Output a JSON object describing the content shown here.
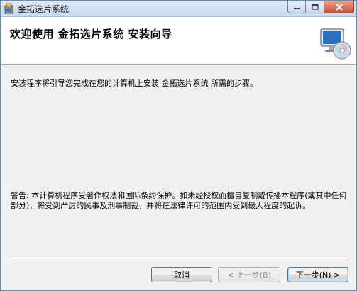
{
  "window": {
    "title": "金拓选片系统"
  },
  "header": {
    "title": "欢迎使用  金拓选片系统  安装向导"
  },
  "body": {
    "intro": "安装程序将引导您完成在您的计算机上安装 金拓选片系统 所需的步骤。",
    "warning": "警告: 本计算机程序受著作权法和国际条约保护。如未经授权而擅自复制或传播本程序(或其中任何部分)，将受到严厉的民事及刑事制裁，并将在法律许可的范围内受到最大程度的起诉。"
  },
  "buttons": {
    "cancel": "取消",
    "back": "< 上一步(B)",
    "next": "下一步(N) >"
  },
  "icons": {
    "app": "installer-app-icon",
    "header": "computer-cd-icon",
    "minimize": "minimize-icon",
    "maximize": "maximize-icon",
    "close": "close-icon"
  },
  "colors": {
    "titlebar": "#c9daf0",
    "close_button": "#c7503a",
    "dialog_bg": "#f0f0f0",
    "header_bg": "#ffffff"
  }
}
